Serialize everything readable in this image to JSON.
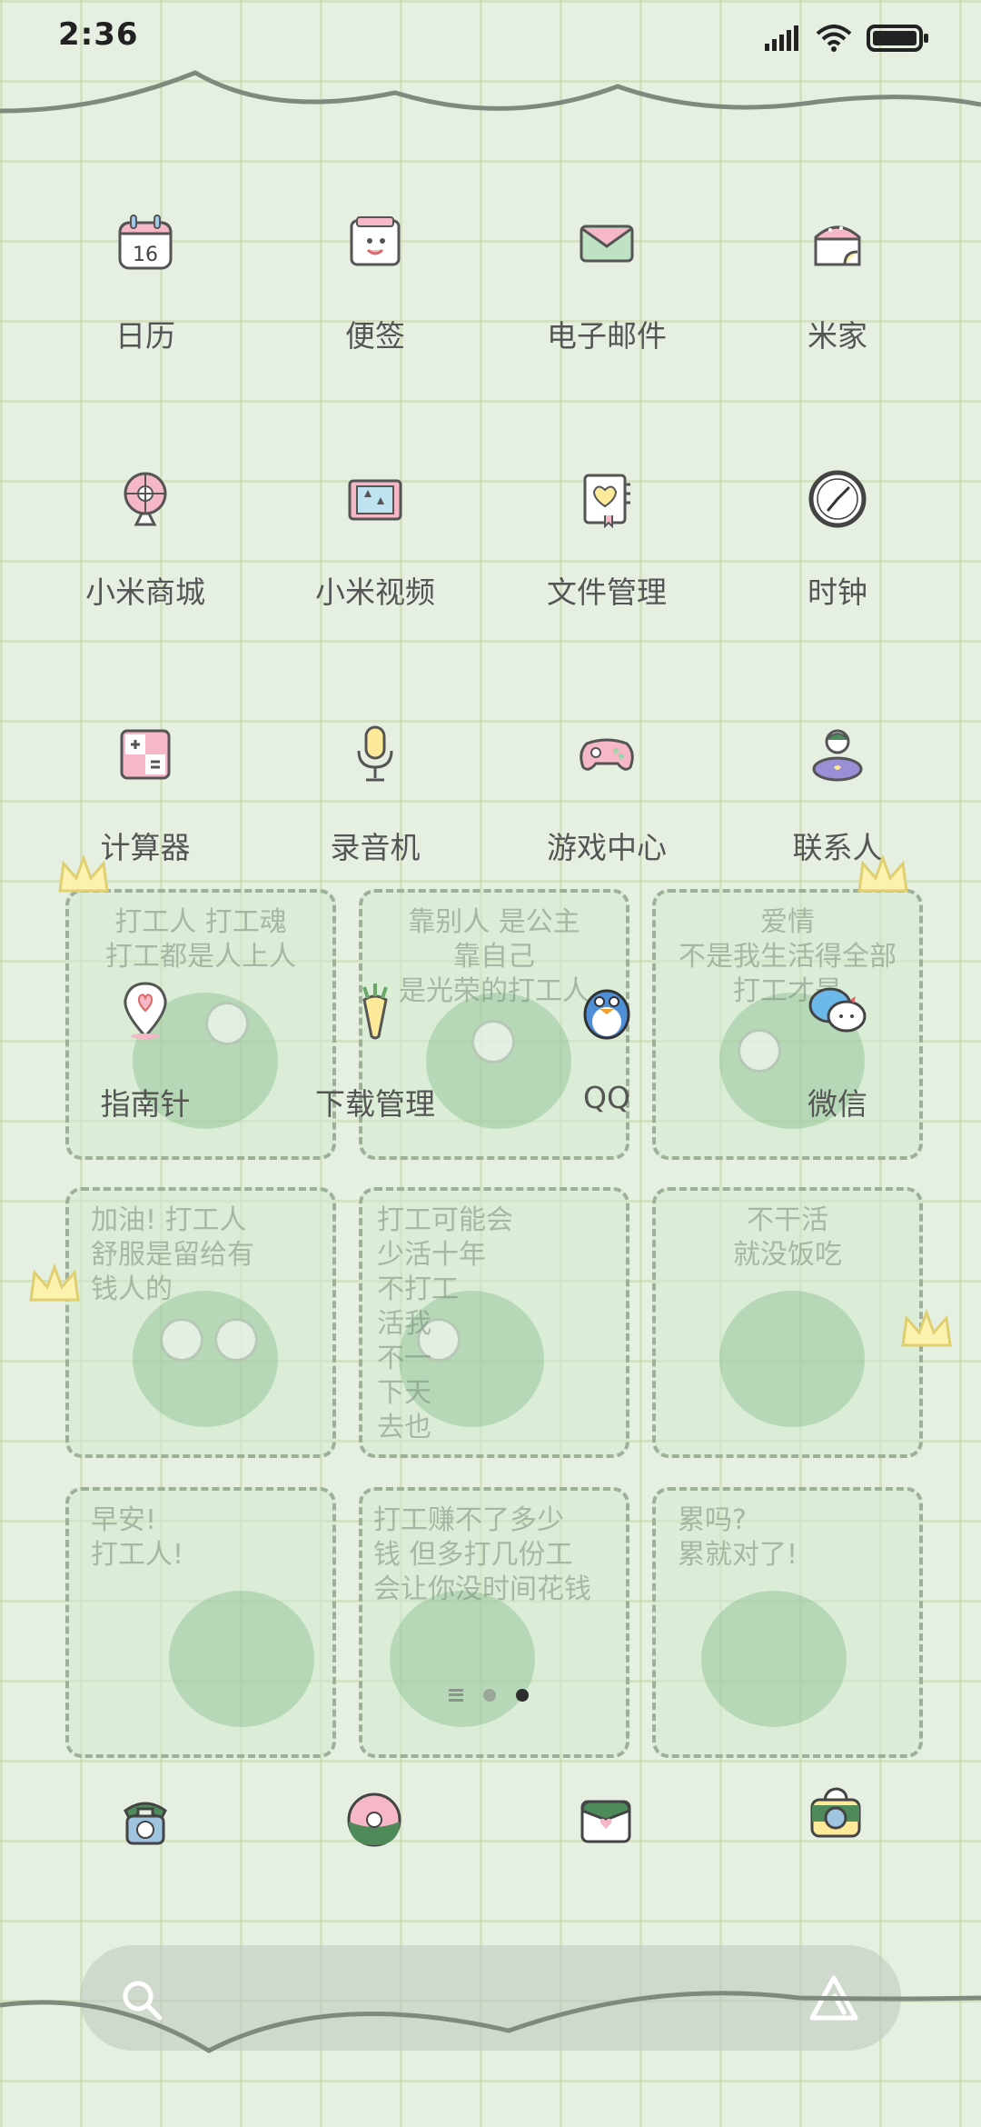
{
  "status_bar": {
    "time": "2:36"
  },
  "apps": [
    {
      "label": "日历",
      "icon": "calendar-icon",
      "day": "16"
    },
    {
      "label": "便签",
      "icon": "notes-icon"
    },
    {
      "label": "电子邮件",
      "icon": "email-icon"
    },
    {
      "label": "米家",
      "icon": "mi-home-icon"
    },
    {
      "label": "小米商城",
      "icon": "mi-store-icon"
    },
    {
      "label": "小米视频",
      "icon": "mi-video-icon"
    },
    {
      "label": "文件管理",
      "icon": "file-manager-icon"
    },
    {
      "label": "时钟",
      "icon": "clock-icon"
    },
    {
      "label": "计算器",
      "icon": "calculator-icon"
    },
    {
      "label": "录音机",
      "icon": "recorder-icon"
    },
    {
      "label": "游戏中心",
      "icon": "game-center-icon"
    },
    {
      "label": "联系人",
      "icon": "contacts-icon"
    },
    {
      "label": "指南针",
      "icon": "compass-icon"
    },
    {
      "label": "下载管理",
      "icon": "downloads-icon"
    },
    {
      "label": "QQ",
      "icon": "qq-icon"
    },
    {
      "label": "微信",
      "icon": "wechat-icon"
    }
  ],
  "stickers": [
    {
      "text": "打工人 打工魂\n打工都是人上人"
    },
    {
      "text": "靠别人 是公主\n靠自己\n是光荣的打工人"
    },
    {
      "text": "爱情\n不是我生活得全部\n打工才是"
    },
    {
      "text": "加油! 打工人\n舒服是留给有\n钱人的"
    },
    {
      "text": "打工可能会\n少活十年\n不打工\n活我\n不一\n下天\n去也"
    },
    {
      "text": "不干活\n就没饭吃"
    },
    {
      "text": "早安!\n打工人!"
    },
    {
      "text": "打工赚不了多少\n钱  但多打几份工\n会让你没时间花钱"
    },
    {
      "text": "累吗?\n累就对了!"
    }
  ],
  "dock": [
    {
      "icon": "phone-icon"
    },
    {
      "icon": "browser-icon"
    },
    {
      "icon": "messages-icon"
    },
    {
      "icon": "camera-icon"
    }
  ],
  "page_indicator": {
    "pages": 2,
    "current": 2
  },
  "colors": {
    "background": "#e6f0e2",
    "grid": "#c4d6aa",
    "accent_pink": "#f2b8c6",
    "accent_green": "#4e8a5a"
  }
}
